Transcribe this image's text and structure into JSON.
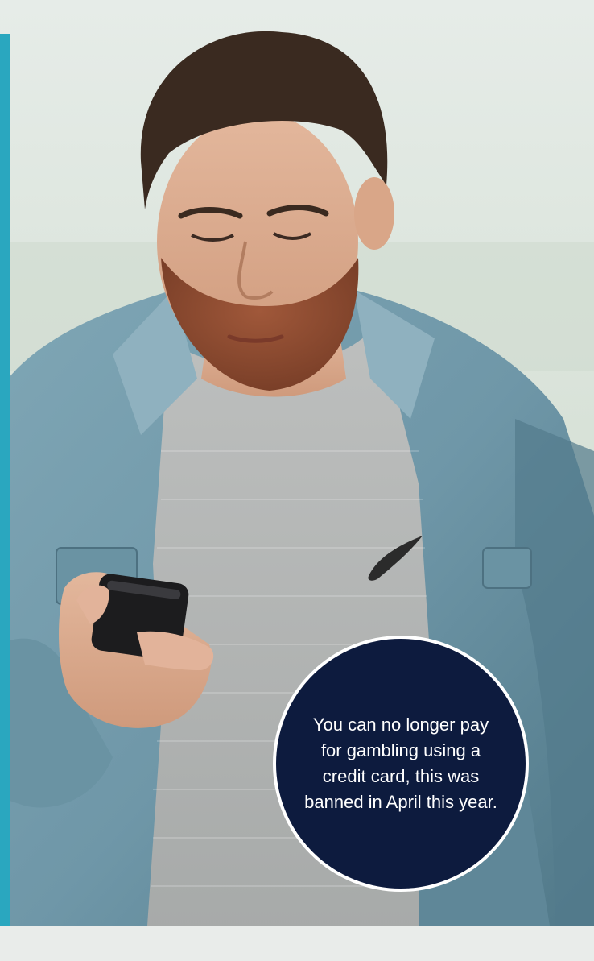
{
  "callout": {
    "text": "You can no longer pay for gambling using a credit card, this was banned in April this year."
  },
  "colors": {
    "accent_bar": "#2aa7bf",
    "callout_background": "#0d1b3e",
    "callout_text": "#ffffff"
  },
  "photo": {
    "subject": "man-looking-at-phone"
  }
}
